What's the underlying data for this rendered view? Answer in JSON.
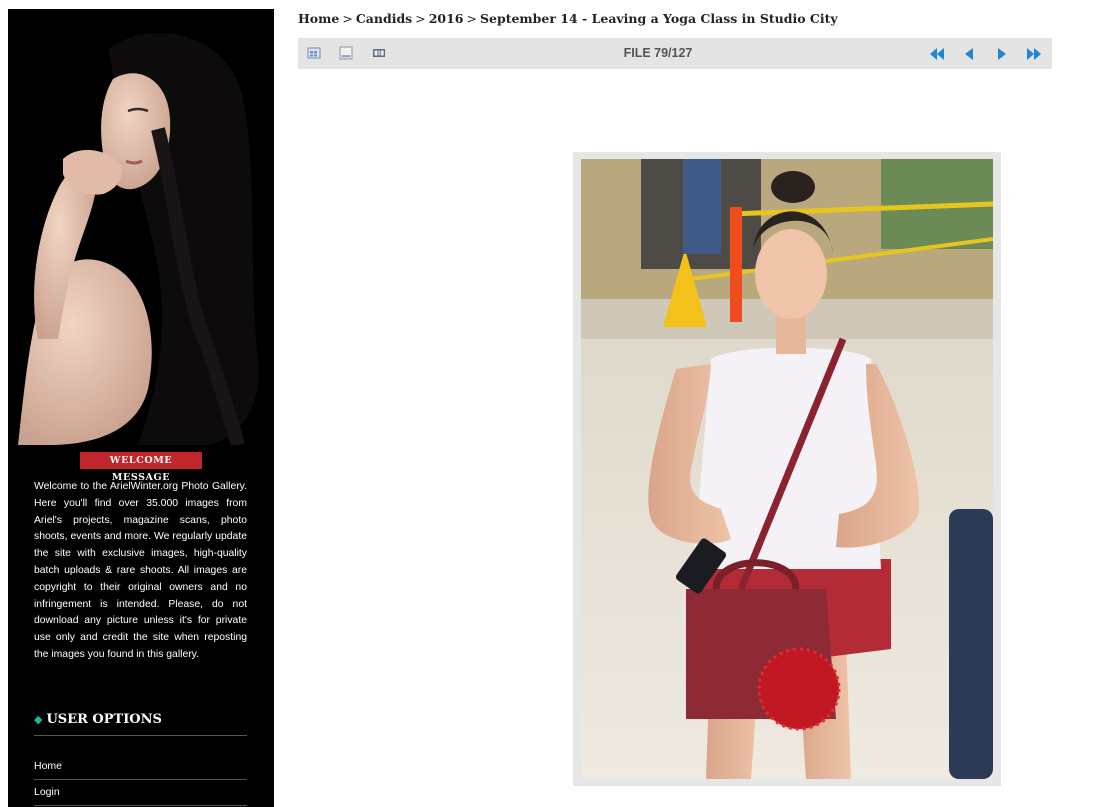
{
  "breadcrumb": {
    "items": [
      "Home",
      "Candids",
      "2016",
      "September 14 - Leaving a Yoga Class in Studio City"
    ],
    "separator": ">"
  },
  "toolbar": {
    "icons": [
      "thumbnails-icon",
      "file-info-icon",
      "slideshow-icon"
    ],
    "file_counter": "FILE 79/127",
    "nav_icons": [
      "first-icon",
      "previous-icon",
      "next-icon",
      "last-icon"
    ]
  },
  "sidebar": {
    "welcome_title": "WELCOME MESSAGE",
    "welcome_text": "Welcome to the ArielWinter.org Photo Gallery. Here you'll find over 35.000 images from Ariel's projects, magazine scans, photo shoots, events and more. We regularly update the site with exclusive images, high-quality batch uploads & rare shoots. All images are copyright to their original owners and no infringement is intended. Please, do not download any picture unless it's for private use only and credit the site when reposting the images you found in this gallery.",
    "user_options_title": "USER OPTIONS",
    "user_options": [
      "Home",
      "Login"
    ]
  },
  "colors": {
    "sidebar_bg": "#000000",
    "badge_bg": "#c0262c",
    "accent_diamond": "#1bb5a0",
    "toolbar_bg": "#e4e4e4",
    "nav_arrow": "#1f86d6"
  }
}
